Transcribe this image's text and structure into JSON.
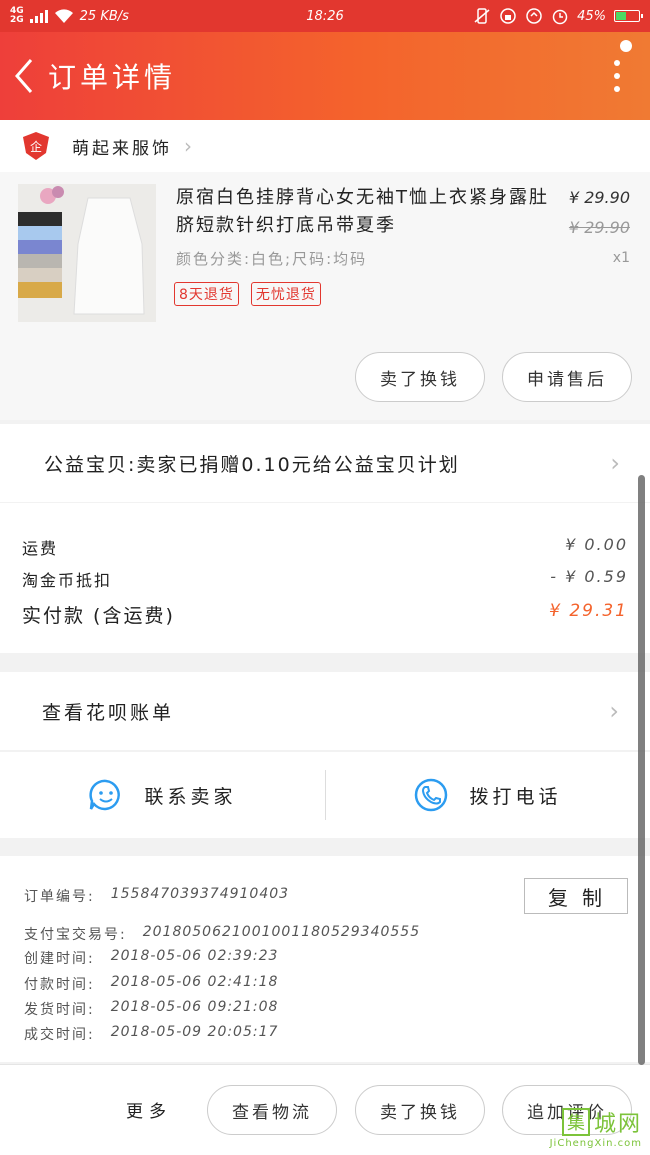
{
  "status_bar": {
    "network": "4G",
    "network2": "2G",
    "speed": "25 KB/s",
    "time": "18:26",
    "battery": "45%",
    "battery_level": 0.45
  },
  "header": {
    "title": "订单详情"
  },
  "store": {
    "name": "萌起来服饰"
  },
  "product": {
    "title": "原宿白色挂脖背心女无袖T恤上衣紧身露肚脐短款针织打底吊带夏季",
    "spec": "颜色分类:白色;尺码:均码",
    "price": "¥ 29.90",
    "original_price": "¥ 29.90",
    "quantity": "x1",
    "tags": [
      "8天退货",
      "无忧退货"
    ]
  },
  "product_actions": {
    "sell_label": "卖了换钱",
    "aftersale_label": "申请售后"
  },
  "donation": {
    "text": "公益宝贝:卖家已捐赠0.10元给公益宝贝计划"
  },
  "fees": {
    "shipping_label": "运费",
    "shipping_value": "¥ 0.00",
    "coin_label": "淘金币抵扣",
    "coin_value": "- ¥ 0.59",
    "total_label": "实付款 (含运费)",
    "total_value": "¥ 29.31"
  },
  "huabei": {
    "label": "查看花呗账单"
  },
  "contact": {
    "seller_label": "联系卖家",
    "phone_label": "拨打电话"
  },
  "order_info": {
    "copy_label": "复制",
    "rows": [
      {
        "key": "订单编号:",
        "value": "155847039374910403"
      },
      {
        "key": "支付宝交易号:",
        "value": "2018050621001001180529340555"
      },
      {
        "key": "创建时间:",
        "value": "2018-05-06 02:39:23"
      },
      {
        "key": "付款时间:",
        "value": "2018-05-06 02:41:18"
      },
      {
        "key": "发货时间:",
        "value": "2018-05-06 09:21:08"
      },
      {
        "key": "成交时间:",
        "value": "2018-05-09 20:05:17"
      }
    ]
  },
  "bottom_bar": {
    "more_label": "更多",
    "logistics_label": "查看物流",
    "sell_label": "卖了换钱",
    "review_label": "追加评价"
  },
  "watermark": {
    "box": "集",
    "text": "城网",
    "url": "JiChengXin.com"
  },
  "colors": {
    "brand_red": "#e2372f",
    "brand_orange": "#f4632c",
    "accent_blue": "#2c9cf0"
  }
}
